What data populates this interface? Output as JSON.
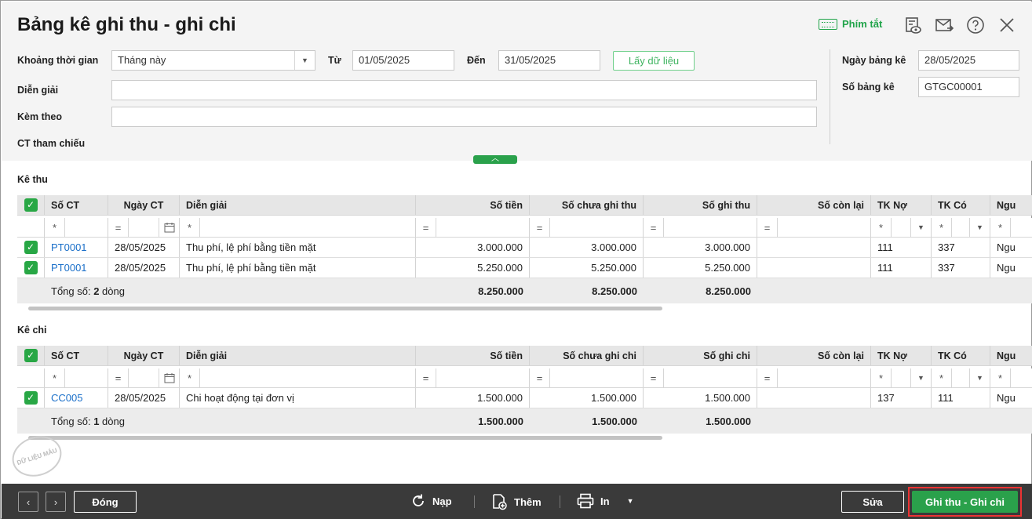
{
  "header": {
    "title": "Bảng kê ghi thu - ghi chi",
    "hotkey_label": "Phím tắt"
  },
  "form": {
    "period_label": "Khoảng thời gian",
    "period_value": "Tháng này",
    "from_label": "Từ",
    "from_value": "01/05/2025",
    "to_label": "Đến",
    "to_value": "31/05/2025",
    "fetch_button": "Lấy dữ liệu",
    "description_label": "Diễn giải",
    "description_value": "",
    "attach_label": "Kèm theo",
    "attach_value": "",
    "reference_label": "CT tham chiếu",
    "list_date_label": "Ngày bảng kê",
    "list_date_value": "28/05/2025",
    "list_no_label": "Số bảng kê",
    "list_no_value": "GTGC00001"
  },
  "receipts": {
    "section_label": "Kê thu",
    "columns": [
      "Số CT",
      "Ngày CT",
      "Diễn giải",
      "Số tiền",
      "Số chưa ghi thu",
      "Số ghi thu",
      "Số còn lại",
      "TK Nợ",
      "TK Có",
      "Ngu"
    ],
    "rows": [
      {
        "no": "PT0001",
        "date": "28/05/2025",
        "desc": "Thu phí, lệ phí bằng tiền mặt",
        "amount": "3.000.000",
        "unrecorded": "3.000.000",
        "recorded": "3.000.000",
        "remaining": "",
        "debit": "111",
        "credit": "337",
        "source": "Ngu"
      },
      {
        "no": "PT0001",
        "date": "28/05/2025",
        "desc": "Thu phí, lệ phí bằng tiền mặt",
        "amount": "5.250.000",
        "unrecorded": "5.250.000",
        "recorded": "5.250.000",
        "remaining": "",
        "debit": "111",
        "credit": "337",
        "source": "Ngu"
      }
    ],
    "total_prefix": "Tổng số: ",
    "total_count": "2",
    "total_suffix": " dòng",
    "total_amount": "8.250.000",
    "total_unrecorded": "8.250.000",
    "total_recorded": "8.250.000"
  },
  "payments": {
    "section_label": "Kê chi",
    "columns": [
      "Số CT",
      "Ngày CT",
      "Diễn giải",
      "Số tiền",
      "Số chưa ghi chi",
      "Số ghi chi",
      "Số còn lại",
      "TK Nợ",
      "TK Có",
      "Ngu"
    ],
    "rows": [
      {
        "no": "CC005",
        "date": "28/05/2025",
        "desc": "Chi hoạt động tại đơn vị",
        "amount": "1.500.000",
        "unrecorded": "1.500.000",
        "recorded": "1.500.000",
        "remaining": "",
        "debit": "137",
        "credit": "111",
        "source": "Ngu"
      }
    ],
    "total_prefix": "Tổng số: ",
    "total_count": "1",
    "total_suffix": " dòng",
    "total_amount": "1.500.000",
    "total_unrecorded": "1.500.000",
    "total_recorded": "1.500.000"
  },
  "filters": {
    "star": "*",
    "eq": "="
  },
  "watermark": "DỮ LIỆU MẪU",
  "footer": {
    "close": "Đóng",
    "reload": "Nạp",
    "add": "Thêm",
    "print": "In",
    "edit": "Sửa",
    "primary": "Ghi thu - Ghi chi"
  },
  "colors": {
    "accent": "#2aa14b",
    "link": "#1a6fc9",
    "highlight": "#e33333"
  }
}
